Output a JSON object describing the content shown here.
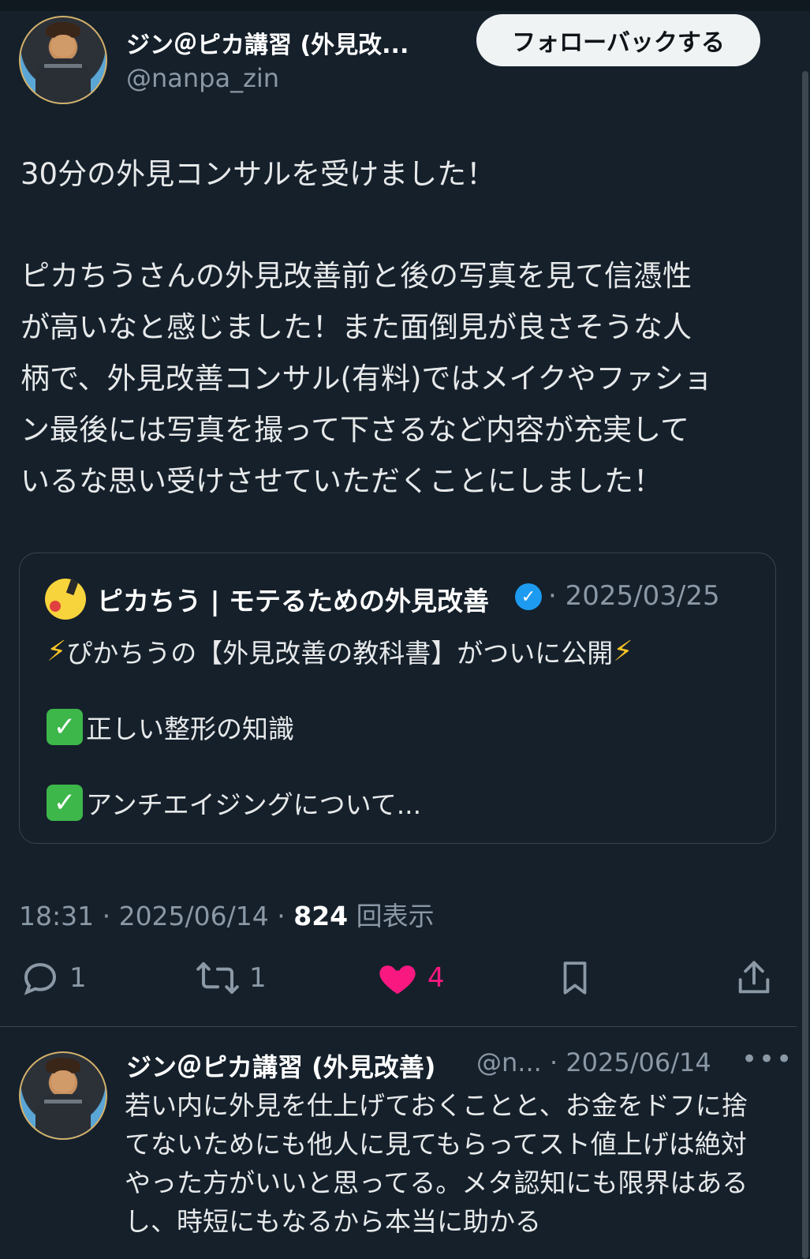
{
  "header": {
    "display_name": "ジン＠ピカ講習 (外見改...",
    "handle": "@nanpa_zin",
    "follow_back_label": "フォローバックする"
  },
  "tweet": {
    "line1": "30分の外見コンサルを受けました！",
    "para": [
      "ピカちうさんの外見改善前と後の写真を見て信憑性",
      "が高いなと感じました！また面倒見が良さそうな人",
      "柄で、外見改善コンサル(有料)ではメイクやファショ",
      "ン最後には写真を撮って下さるなど内容が充実して",
      "いるな思い受けさせていただくことにしました！"
    ]
  },
  "quote": {
    "name": "ピカちう | モテるための外見改善",
    "date": "· 2025/03/25",
    "headline": "ぴかちうの【外見改善の教科書】がついに公開",
    "item1": "正しい整形の知識",
    "item2": "アンチエイジングについて..."
  },
  "meta": {
    "time": "18:31 · 2025/06/14 · ",
    "views": "824",
    "views_label": " 回表示"
  },
  "actions": {
    "reply_count": "1",
    "retweet_count": "1",
    "like_count": "4",
    "like_color": "#f91880"
  },
  "reply": {
    "display_name": "ジン＠ピカ講習 (外見改善)",
    "handle_date": "@n... · 2025/06/14",
    "more": "•••",
    "text": "若い内に外見を仕上げておくことと、お金をドフに捨てないためにも他人に見てもらってスト値上げは絶対やった方がいいと思ってる。メタ認知にも限界はあるし、時短にもなるから本当に助かる"
  },
  "colors": {
    "background": "#15202b",
    "verified": "#1d9bf0",
    "checkmark": "#3db64a"
  }
}
